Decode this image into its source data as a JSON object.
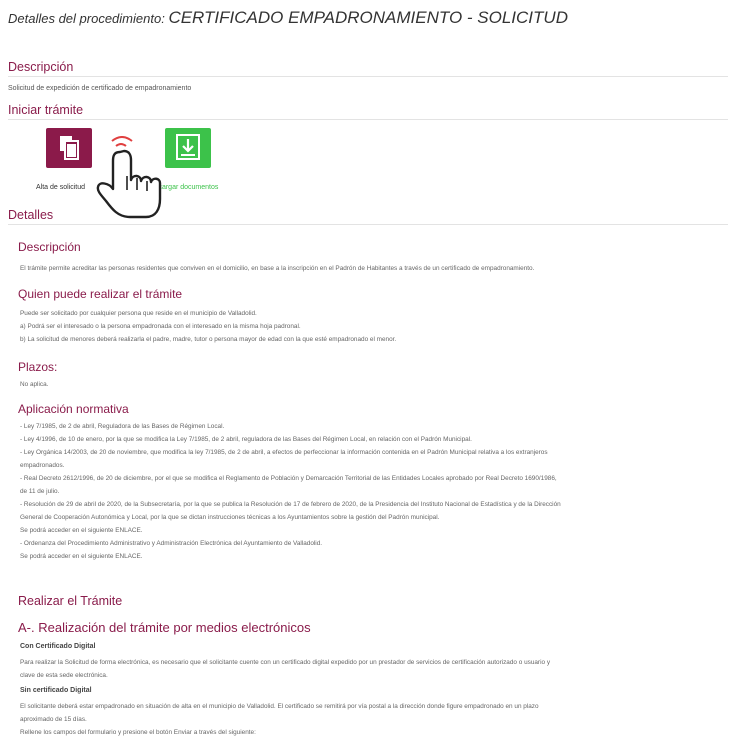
{
  "page": {
    "title_lead": "Detalles del procedimiento:",
    "title_name": "CERTIFICADO EMPADRONAMIENTO - SOLICITUD"
  },
  "descripcion": {
    "heading": "Descripción",
    "text": "Solicitud de expedición de certificado de empadronamiento"
  },
  "iniciar": {
    "heading": "Iniciar trámite",
    "alta_label": "Alta de solicitud",
    "descargar_label": "Descargar documentos",
    "alta_color": "#8b1a4a",
    "descargar_color": "#3cc24a"
  },
  "detalles": {
    "heading": "Detalles",
    "descripcion_heading": "Descripción",
    "descripcion_text": "El trámite permite acreditar las personas residentes que conviven en el domicilio, en base a la inscripción en el Padrón de Habitantes a través de un certificado de empadronamiento.",
    "quien_heading": "Quien puede realizar el trámite",
    "quien_lines": [
      "Puede ser solicitado por cualquier persona que reside en el municipio de Valladolid.",
      "a) Podrá ser el interesado o la persona empadronada con el interesado en la misma hoja padronal.",
      "b) La solicitud de menores deberá realizarla el padre, madre, tutor o persona mayor de edad con la que esté empadronado el menor."
    ],
    "plazos_heading": "Plazos:",
    "plazos_text": "No aplica.",
    "normativa_heading": "Aplicación normativa",
    "normativa_lines": [
      "- Ley 7/1985, de 2 de abril, Reguladora de las Bases de Régimen Local.",
      "- Ley 4/1996, de 10 de enero, por la que se modifica la Ley 7/1985, de 2 abril, reguladora de las Bases del Régimen Local, en relación con el Padrón Municipal.",
      "- Ley Orgánica 14/2003, de 20 de noviembre, que modifica la ley 7/1985, de 2 de abril, a efectos de perfeccionar la información contenida en el Padrón Municipal relativa a los extranjeros",
      "empadronados.",
      "- Real Decreto 2612/1996, de 20 de diciembre, por el que se modifica el Reglamento de Población y Demarcación Territorial de las Entidades Locales aprobado por Real Decreto 1690/1986,",
      "de 11 de julio.",
      "- Resolución de 29 de abril de 2020, de la Subsecretaría, por la que se publica la Resolución de 17 de febrero de 2020, de la Presidencia del Instituto Nacional de Estadística y de la Dirección",
      "General de Cooperación Autonómica y Local, por la que se dictan instrucciones técnicas a los Ayuntamientos sobre la gestión del Padrón municipal.",
      "Se podrá acceder en el siguiente ENLACE.",
      "- Ordenanza del Procedimiento Administrativo y Administración Electrónica del Ayuntamiento de Valladolid.",
      "Se podrá acceder en el siguiente ENLACE."
    ]
  },
  "realizar": {
    "heading": "Realizar el Trámite",
    "sub_heading": "A-. Realización del trámite por medios electrónicos",
    "con_cert_heading": "Con Certificado Digital",
    "con_cert_lines": [
      "Para realizar la Solicitud de forma electrónica, es necesario que el solicitante cuente con un certificado digital expedido por un prestador de servicios de certificación autorizado o usuario y",
      "clave de esta sede electrónica."
    ],
    "sin_cert_heading": "Sin certificado Digital",
    "sin_cert_lines": [
      "El solicitante deberá estar empadronado en situación de alta en el municipio de Valladolid. El certificado se remitirá por vía postal a la dirección donde figure empadronado en un plazo",
      "aproximado de 15 días.",
      "Rellene los campos del formulario y presione el botón Enviar a través del siguiente:"
    ]
  }
}
